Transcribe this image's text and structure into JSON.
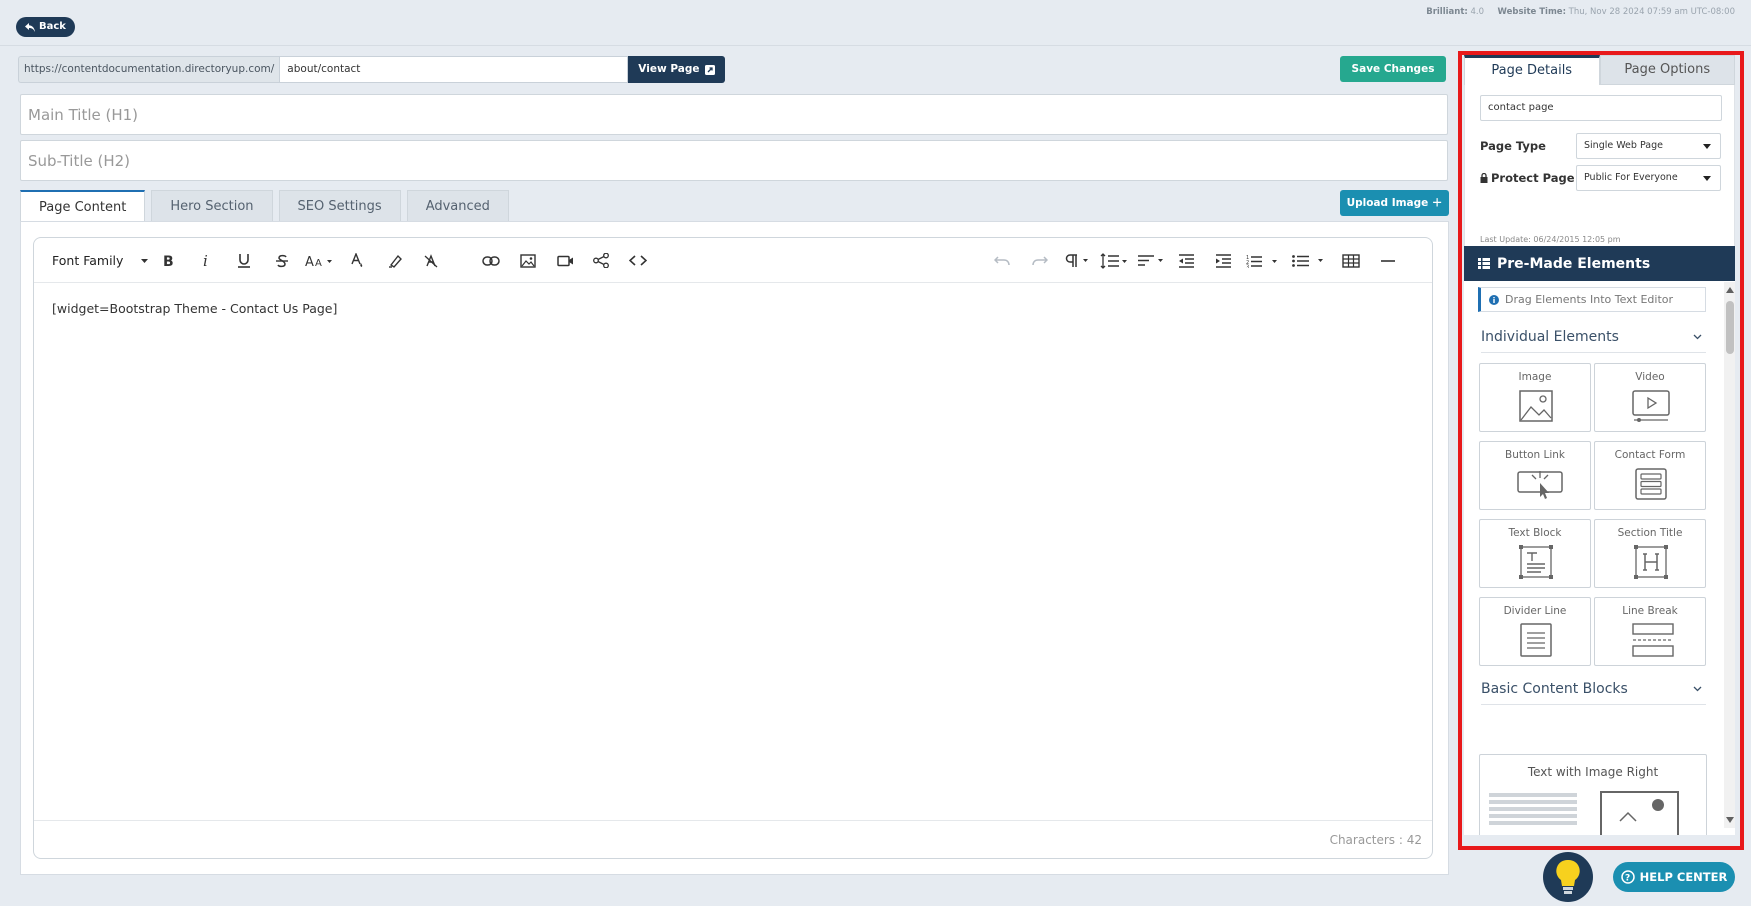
{
  "topbar": {
    "back_label": "Back",
    "brilliant_label": "Brilliant:",
    "brilliant_value": "4.0",
    "website_time_label": "Website Time:",
    "website_time_value": "Thu, Nov 28 2024 07:59 am UTC-08:00"
  },
  "url_bar": {
    "prefix": "https://contentdocumentation.directoryup.com/",
    "slug": "about/contact",
    "view_page_label": "View Page"
  },
  "save_label": "Save Changes",
  "fields": {
    "main_title_placeholder": "Main Title (H1)",
    "sub_title_placeholder": "Sub-Title (H2)"
  },
  "tabs": [
    "Page Content",
    "Hero Section",
    "SEO Settings",
    "Advanced"
  ],
  "upload_label": "Upload Image",
  "editor": {
    "font_family_label": "Font Family",
    "content": "[widget=Bootstrap Theme - Contact Us Page]",
    "char_count": "Characters : 42"
  },
  "sidebar": {
    "tabs": [
      "Page Details",
      "Page Options"
    ],
    "page_name": "contact page",
    "page_type_label": "Page Type",
    "page_type_value": "Single Web Page",
    "protect_label": "Protect Page",
    "protect_value": "Public For Everyone",
    "last_update": "Last Update: 06/24/2015 12:05 pm",
    "premade_title": "Pre-Made Elements",
    "hint": "Drag Elements Into Text Editor",
    "section_individual": "Individual Elements",
    "elements": [
      {
        "label": "Image",
        "icon": "image-icon"
      },
      {
        "label": "Video",
        "icon": "video-icon"
      },
      {
        "label": "Button Link",
        "icon": "button-link-icon"
      },
      {
        "label": "Contact Form",
        "icon": "contact-form-icon"
      },
      {
        "label": "Text Block",
        "icon": "text-block-icon"
      },
      {
        "label": "Section Title",
        "icon": "section-title-icon"
      },
      {
        "label": "Divider Line",
        "icon": "divider-line-icon"
      },
      {
        "label": "Line Break",
        "icon": "line-break-icon"
      }
    ],
    "section_basic": "Basic Content Blocks",
    "basic_first": "Text with Image Right"
  },
  "help": {
    "label": "HELP CENTER"
  },
  "colors": {
    "navy": "#1f3a57",
    "teal": "#26a88f",
    "blue": "#1b8fb1",
    "highlight": "#e8191b"
  }
}
